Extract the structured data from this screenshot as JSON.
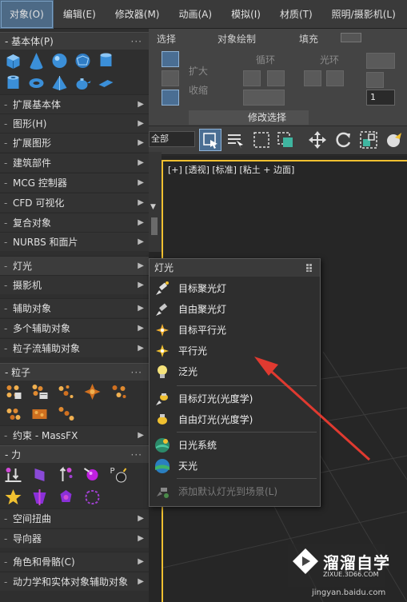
{
  "menubar": {
    "items": [
      "对象(O)",
      "编辑(E)",
      "修改器(M)",
      "动画(A)",
      "模拟(I)",
      "材质(T)",
      "照明/摄影机(L)"
    ]
  },
  "ribbon": {
    "tab_select": "选择",
    "tab_object_paint": "对象绘制",
    "tab_fill": "填充",
    "expand": "扩大",
    "shrink": "收缩",
    "loop": "循环",
    "ring": "光环",
    "modify_select": "修改选择",
    "spinner_value": "1"
  },
  "toolbar": {
    "all_label": "全部"
  },
  "viewport": {
    "label": "[+] [透视] [标准] [粘土 + 边面]"
  },
  "panel": {
    "sections": {
      "basic": "基本体(P)",
      "particles": "粒子",
      "force": "力"
    },
    "rows": {
      "ext_primitives": "扩展基本体",
      "shapes": "图形(H)",
      "ext_shapes": "扩展图形",
      "arch": "建筑部件",
      "mcg": "MCG 控制器",
      "cfd": "CFD 可视化",
      "compound": "复合对象",
      "nurbs": "NURBS 和面片",
      "lights": "灯光",
      "cameras": "摄影机",
      "helpers": "辅助对象",
      "multi_helpers": "多个辅助对象",
      "pflow_helpers": "粒子流辅助对象",
      "constraints": "约束 - MassFX",
      "spacewarps": "空间扭曲",
      "guides": "导向器",
      "character": "角色和骨骼(C)",
      "dynamics": "动力学和实体对象辅助对象"
    }
  },
  "submenu": {
    "title": "灯光",
    "items": {
      "target_spot": "目标聚光灯",
      "free_spot": "自由聚光灯",
      "target_direct": "目标平行光",
      "direct": "平行光",
      "omni": "泛光",
      "target_photometric": "目标灯光(光度学)",
      "free_photometric": "自由灯光(光度学)",
      "sunlight": "日光系统",
      "skylight": "天光",
      "add_default": "添加默认灯光到场景(L)"
    }
  },
  "watermark": {
    "brand": "溜溜自学",
    "sub": "ZIXUE.3D66.COM",
    "site": "jingyan.baidu.com"
  },
  "colors": {
    "accent": "#4d6a86",
    "viewport_border": "#f0c030",
    "arrow": "#e03a30"
  }
}
